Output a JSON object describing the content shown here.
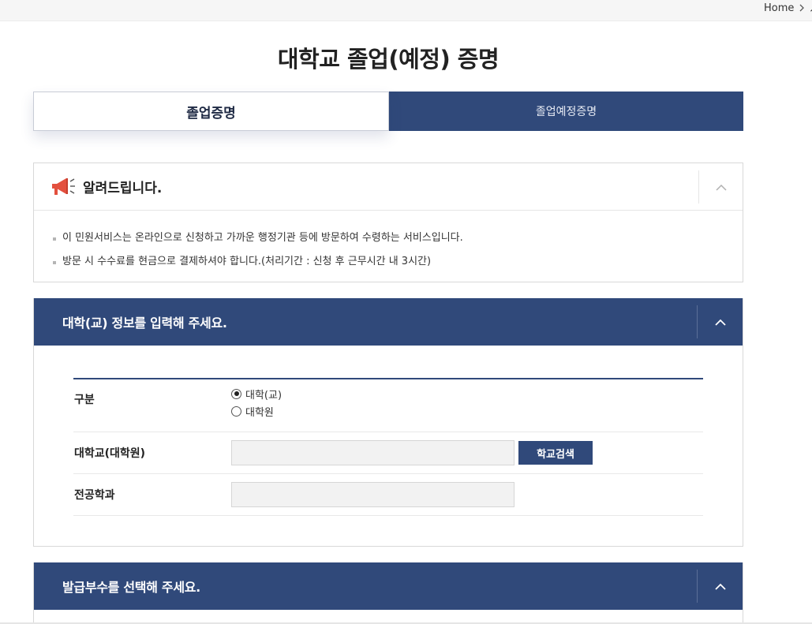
{
  "breadcrumb": {
    "home": "Home",
    "next": "서"
  },
  "page": {
    "title": "대학교 졸업(예정) 증명"
  },
  "tabs": [
    {
      "label": "졸업증명",
      "active": true
    },
    {
      "label": "졸업예정증명",
      "active": false
    }
  ],
  "notice": {
    "title": "알려드립니다.",
    "items": [
      "이 민원서비스는 온라인으로 신청하고 가까운 행정기관 등에 방문하여 수령하는 서비스입니다.",
      "방문 시 수수료를 현금으로 결제하셔야 합니다.(처리기간 : 신청 후 근무시간 내 3시간)"
    ]
  },
  "section_university": {
    "title": "대학(교) 정보를 입력해 주세요.",
    "rows": {
      "type_label": "구분",
      "type_options": [
        "대학(교)",
        "대학원"
      ],
      "type_selected": "대학(교)",
      "school_label": "대학교(대학원)",
      "school_value": "",
      "search_button": "학교검색",
      "major_label": "전공학과",
      "major_value": ""
    }
  },
  "section_copies": {
    "title": "발급부수를 선택해 주세요."
  },
  "colors": {
    "primary": "#30497a",
    "accent_icon": "#e3503e"
  },
  "icons": {
    "notice": "megaphone-icon",
    "collapse": "chevron-up-icon",
    "breadcrumb_sep": "chevron-right-icon"
  }
}
